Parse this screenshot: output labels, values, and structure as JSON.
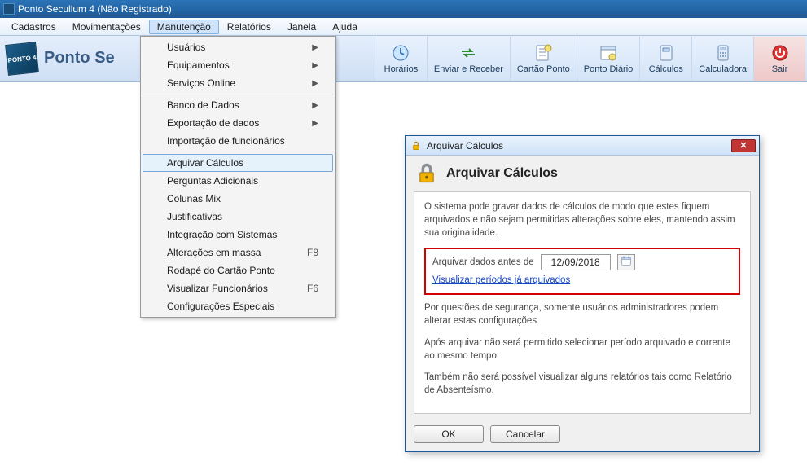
{
  "window": {
    "title": "Ponto Secullum 4  (Não Registrado)"
  },
  "menubar": {
    "items": [
      "Cadastros",
      "Movimentações",
      "Manutenção",
      "Relatórios",
      "Janela",
      "Ajuda"
    ],
    "active_index": 2
  },
  "brand": {
    "text": "Ponto Se",
    "logo_label": "PONTO 4"
  },
  "toolbar": {
    "buttons": [
      {
        "label": "Horários",
        "icon": "clock-icon"
      },
      {
        "label": "Enviar e Receber",
        "icon": "sync-icon"
      },
      {
        "label": "Cartão Ponto",
        "icon": "card-icon"
      },
      {
        "label": "Ponto Diário",
        "icon": "calendar-day-icon"
      },
      {
        "label": "Cálculos",
        "icon": "calc-icon"
      },
      {
        "label": "Calculadora",
        "icon": "calculator-icon"
      },
      {
        "label": "Sair",
        "icon": "power-icon"
      }
    ]
  },
  "dropdown": {
    "groups": [
      [
        {
          "label": "Usuários",
          "submenu": true
        },
        {
          "label": "Equipamentos",
          "submenu": true
        },
        {
          "label": "Serviços Online",
          "submenu": true
        }
      ],
      [
        {
          "label": "Banco de Dados",
          "submenu": true
        },
        {
          "label": "Exportação de dados",
          "submenu": true
        },
        {
          "label": "Importação de funcionários"
        }
      ],
      [
        {
          "label": "Arquivar Cálculos",
          "hot": true
        },
        {
          "label": "Perguntas Adicionais"
        },
        {
          "label": "Colunas Mix"
        },
        {
          "label": "Justificativas"
        },
        {
          "label": "Integração com Sistemas"
        },
        {
          "label": "Alterações em massa",
          "shortcut": "F8"
        },
        {
          "label": "Rodapé do Cartão Ponto"
        },
        {
          "label": "Visualizar Funcionários",
          "shortcut": "F6"
        },
        {
          "label": "Configurações Especiais"
        }
      ]
    ]
  },
  "dialog": {
    "title": "Arquivar Cálculos",
    "heading": "Arquivar Cálculos",
    "intro": "O sistema pode gravar dados de cálculos de modo que estes fiquem arquivados e não sejam permitidas alterações sobre eles, mantendo assim sua originalidade.",
    "date_label": "Arquivar dados antes de",
    "date_value": "12/09/2018",
    "view_link": "Visualizar períodos já arquivados",
    "note1": "Por questões de segurança, somente usuários administradores podem alterar estas configurações",
    "note2": "Após arquivar não será permitido selecionar período arquivado e corrente ao mesmo tempo.",
    "note3": "Também não será possível visualizar alguns relatórios tais como Relatório de Absenteísmo.",
    "ok": "OK",
    "cancel": "Cancelar"
  }
}
